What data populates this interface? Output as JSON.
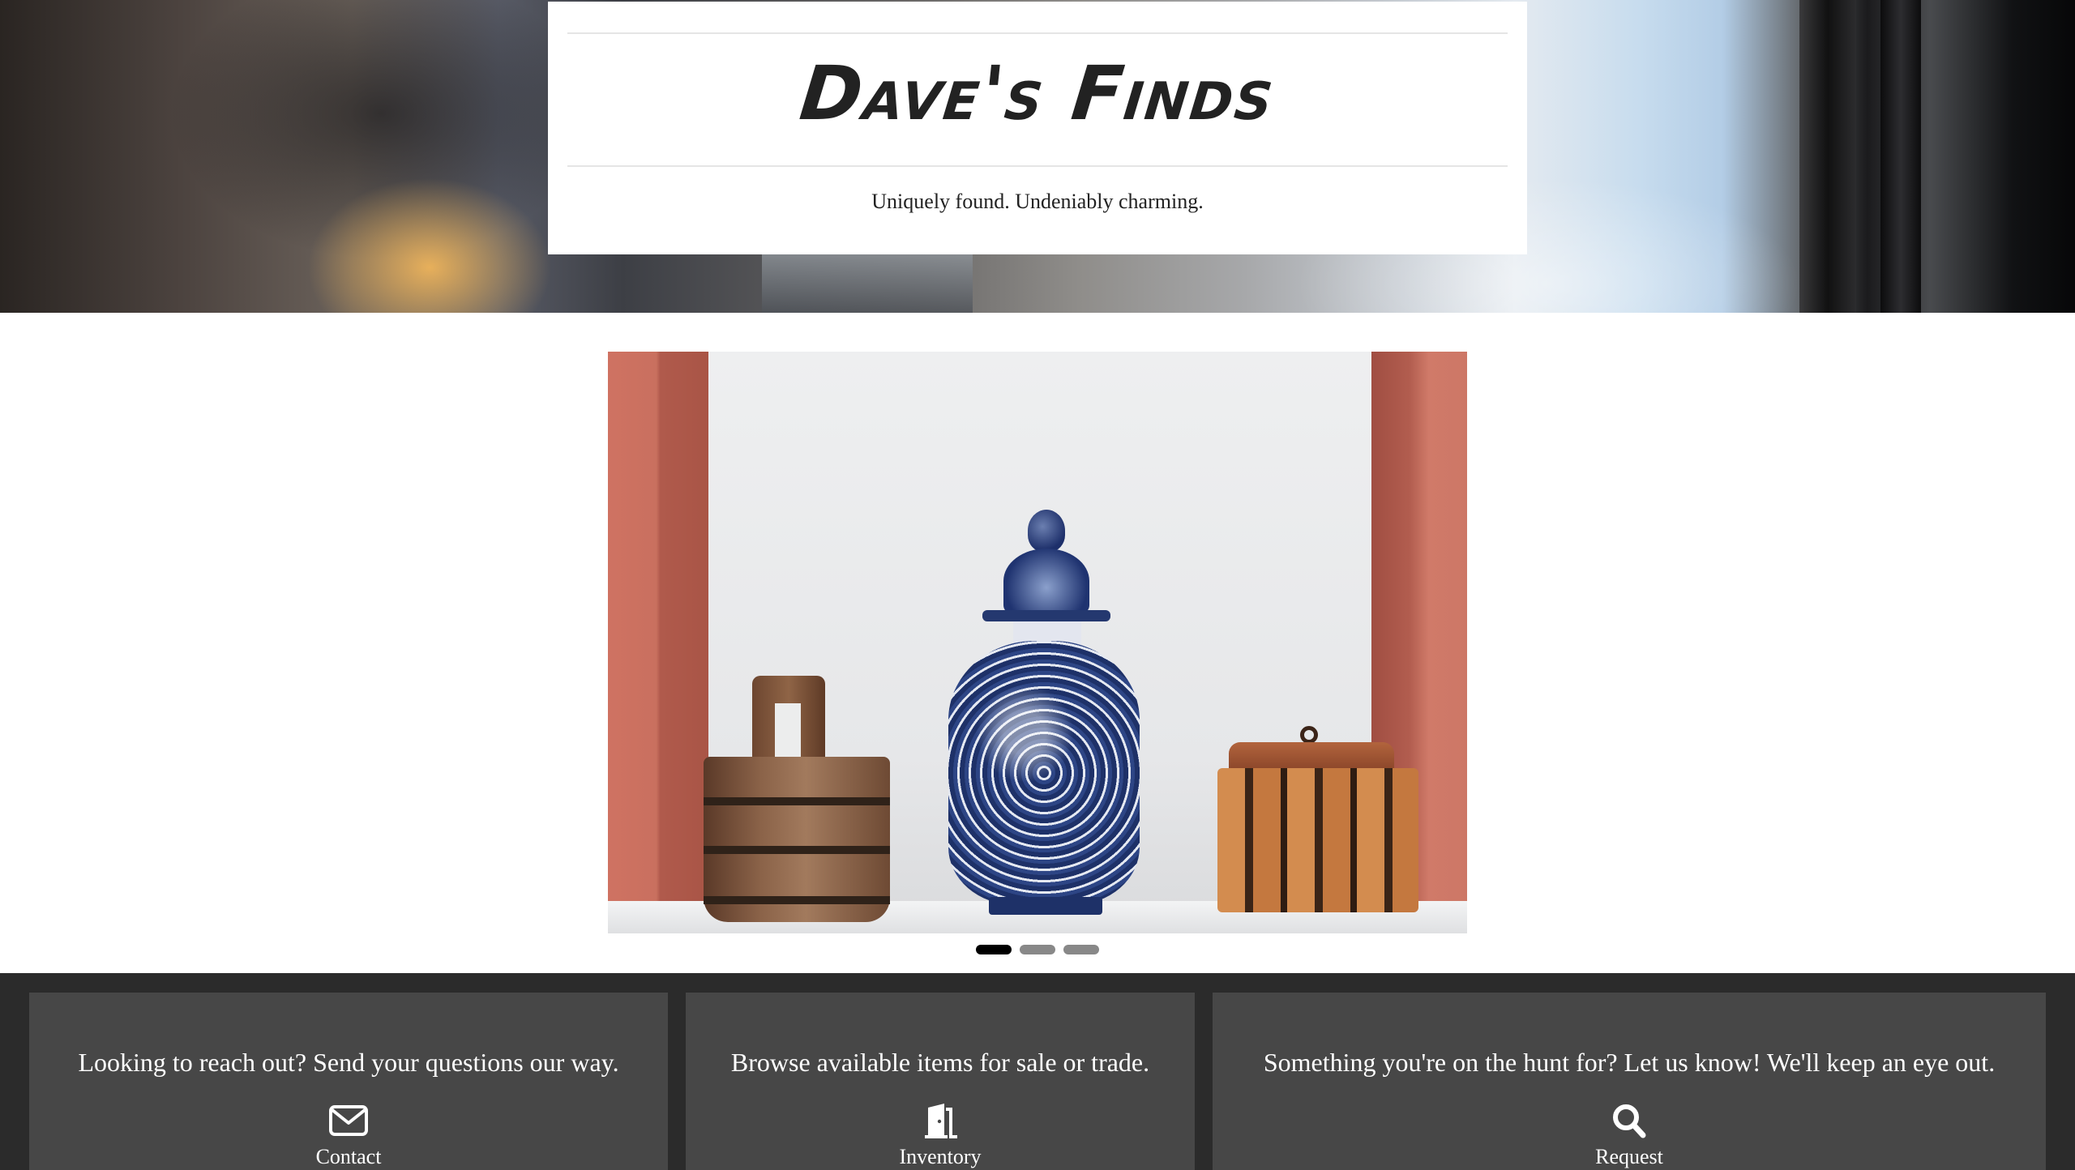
{
  "header": {
    "site_title": "Dave's Finds",
    "tagline": "Uniquely found. Undeniably charming."
  },
  "carousel": {
    "slide_count": 3,
    "active_index": 0
  },
  "cards": [
    {
      "text": "Looking to reach out? Send your questions our way.",
      "icon": "envelope-icon",
      "label": "Contact"
    },
    {
      "text": "Browse available items for sale or trade.",
      "icon": "door-icon",
      "label": "Inventory"
    },
    {
      "text": "Something you're on the hunt for? Let us know! We'll keep an eye out.",
      "icon": "magnifier-icon",
      "label": "Request"
    }
  ],
  "colors": {
    "footer_background": "#2b2b2b",
    "card_background": "#474747",
    "indicator_active": "#000000",
    "indicator_inactive": "#888888"
  }
}
